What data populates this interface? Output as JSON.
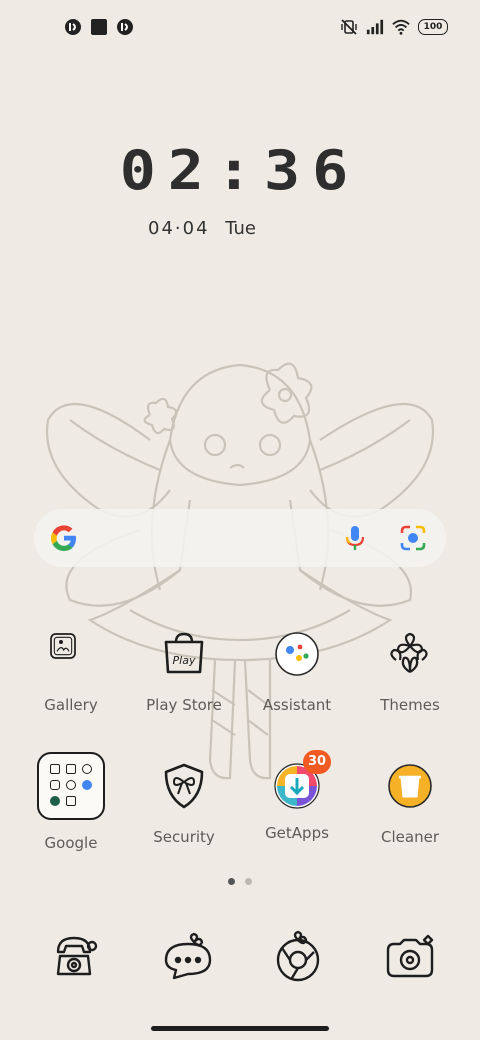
{
  "status_bar": {
    "left_icons": [
      "notification-icon-1",
      "notification-square-icon",
      "notification-icon-2"
    ],
    "right_icons": [
      "mute-vibrate-icon",
      "signal-icon",
      "wifi-icon"
    ],
    "battery": "100"
  },
  "clock": {
    "time": "02:36",
    "date": "04·04",
    "day": "Tue"
  },
  "search_bar": {
    "icons": [
      "google-logo-icon",
      "microphone-icon",
      "lens-icon"
    ]
  },
  "apps_row1": [
    {
      "label": "Gallery",
      "icon": "gallery-icon"
    },
    {
      "label": "Play Store",
      "icon": "play-store-icon"
    },
    {
      "label": "Assistant",
      "icon": "assistant-icon"
    },
    {
      "label": "Themes",
      "icon": "themes-icon"
    }
  ],
  "apps_row2": [
    {
      "label": "Google",
      "icon": "google-folder-icon"
    },
    {
      "label": "Security",
      "icon": "security-icon"
    },
    {
      "label": "GetApps",
      "icon": "getapps-icon",
      "badge": "30"
    },
    {
      "label": "Cleaner",
      "icon": "cleaner-icon"
    }
  ],
  "page_indicator": {
    "pages": 2,
    "active": 1
  },
  "dock": [
    "phone-icon",
    "messages-icon",
    "browser-icon",
    "camera-icon"
  ],
  "colors": {
    "background": "#efebe4",
    "badge": "#f15a22",
    "text": "#5e5b57"
  }
}
